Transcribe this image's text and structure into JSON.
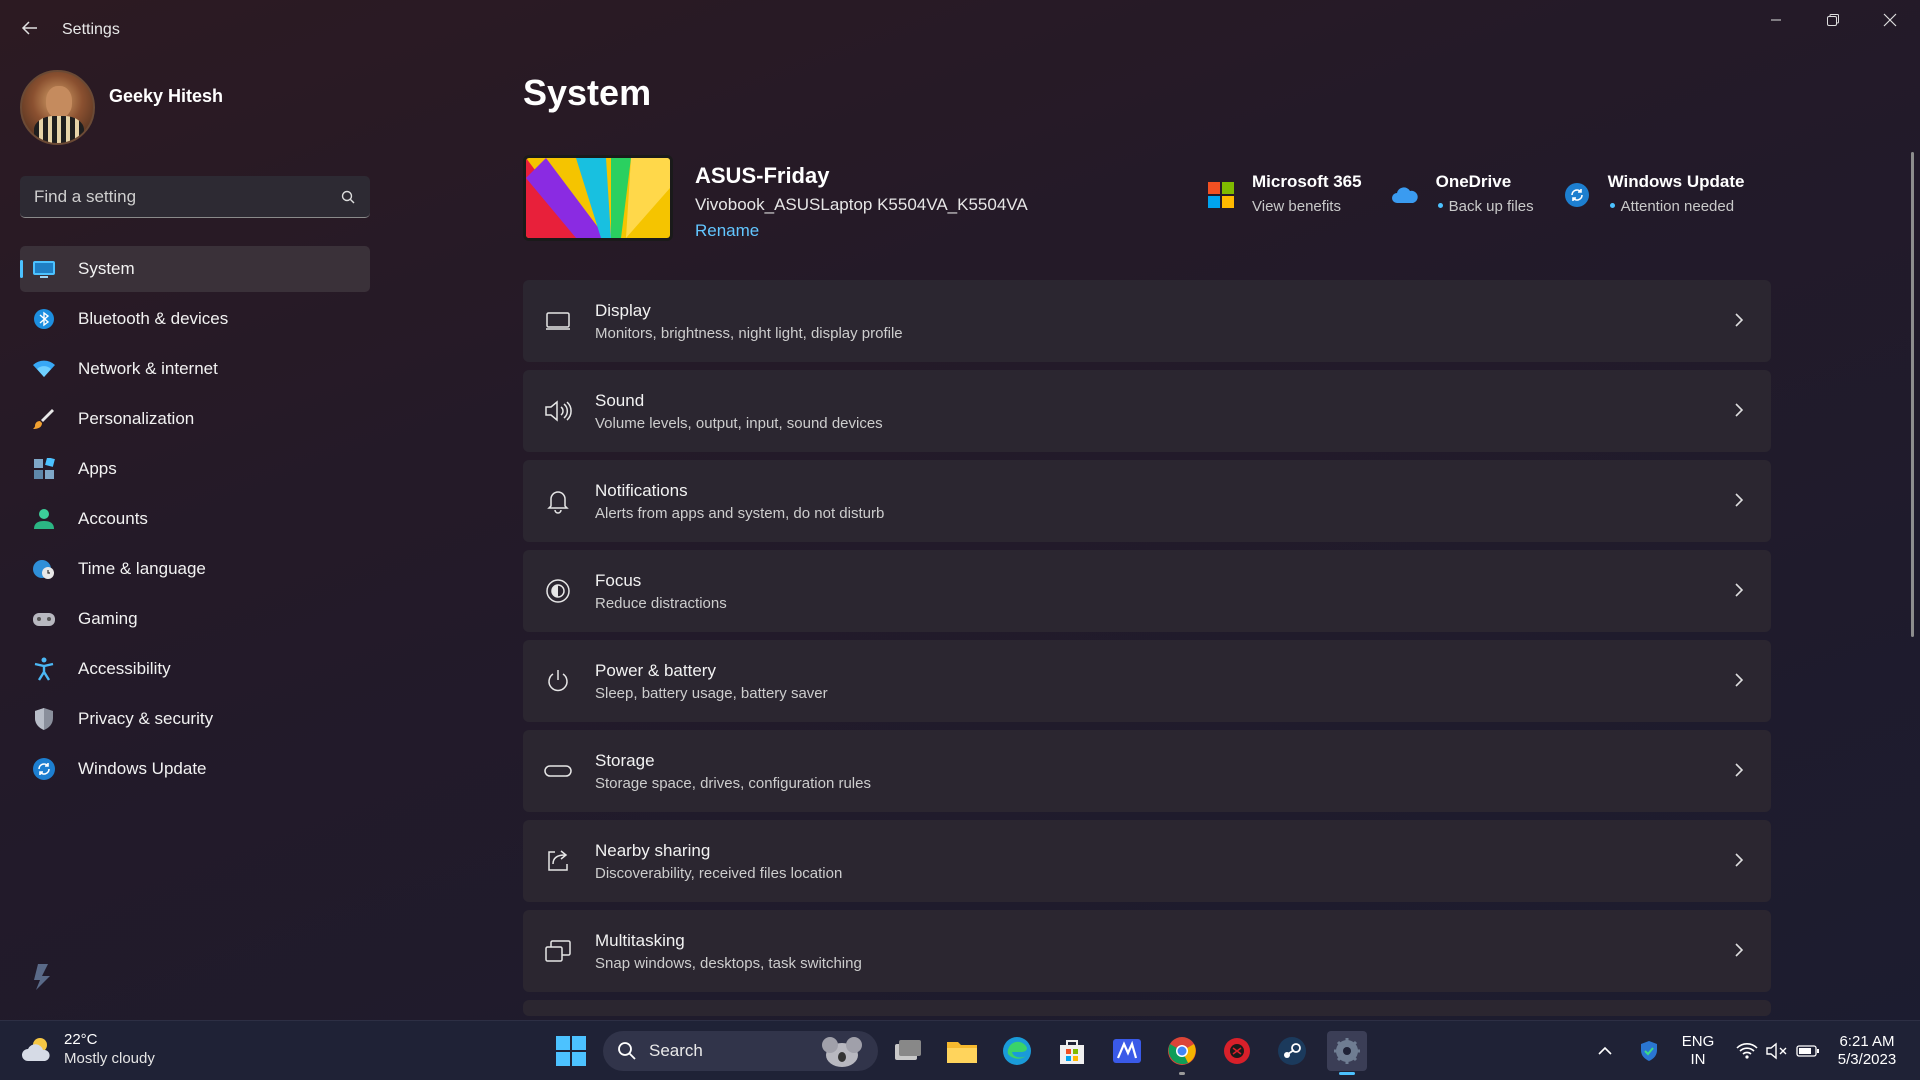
{
  "window": {
    "title": "Settings"
  },
  "profile": {
    "name": "Geeky Hitesh"
  },
  "search": {
    "placeholder": "Find a setting"
  },
  "nav": {
    "items": [
      {
        "label": "System",
        "icon": "system-display-icon",
        "active": true
      },
      {
        "label": "Bluetooth & devices",
        "icon": "bluetooth-icon"
      },
      {
        "label": "Network & internet",
        "icon": "wifi-icon"
      },
      {
        "label": "Personalization",
        "icon": "brush-icon"
      },
      {
        "label": "Apps",
        "icon": "apps-icon"
      },
      {
        "label": "Accounts",
        "icon": "account-icon"
      },
      {
        "label": "Time & language",
        "icon": "globe-clock-icon"
      },
      {
        "label": "Gaming",
        "icon": "gamepad-icon"
      },
      {
        "label": "Accessibility",
        "icon": "accessibility-icon"
      },
      {
        "label": "Privacy & security",
        "icon": "shield-icon"
      },
      {
        "label": "Windows Update",
        "icon": "update-icon"
      }
    ]
  },
  "main": {
    "title": "System",
    "device": {
      "name": "ASUS-Friday",
      "model": "Vivobook_ASUSLaptop K5504VA_K5504VA",
      "rename": "Rename"
    },
    "quick_links": [
      {
        "title": "Microsoft 365",
        "sub": "View benefits",
        "dot": false
      },
      {
        "title": "OneDrive",
        "sub": "Back up files",
        "dot": true
      },
      {
        "title": "Windows Update",
        "sub": "Attention needed",
        "dot": true
      }
    ],
    "settings": [
      {
        "title": "Display",
        "sub": "Monitors, brightness, night light, display profile",
        "icon": "display-icon"
      },
      {
        "title": "Sound",
        "sub": "Volume levels, output, input, sound devices",
        "icon": "speaker-icon"
      },
      {
        "title": "Notifications",
        "sub": "Alerts from apps and system, do not disturb",
        "icon": "bell-icon"
      },
      {
        "title": "Focus",
        "sub": "Reduce distractions",
        "icon": "focus-icon"
      },
      {
        "title": "Power & battery",
        "sub": "Sleep, battery usage, battery saver",
        "icon": "power-icon"
      },
      {
        "title": "Storage",
        "sub": "Storage space, drives, configuration rules",
        "icon": "storage-icon"
      },
      {
        "title": "Nearby sharing",
        "sub": "Discoverability, received files location",
        "icon": "share-icon"
      },
      {
        "title": "Multitasking",
        "sub": "Snap windows, desktops, task switching",
        "icon": "multitasking-icon"
      }
    ]
  },
  "taskbar": {
    "weather_temp": "22°C",
    "weather_cond": "Mostly cloudy",
    "search_label": "Search",
    "lang_top": "ENG",
    "lang_bottom": "IN",
    "time": "6:21 AM",
    "date": "5/3/2023"
  },
  "colors": {
    "accent": "#4cc2ff",
    "card": "#2b2630",
    "taskbar": "#1f2236"
  }
}
